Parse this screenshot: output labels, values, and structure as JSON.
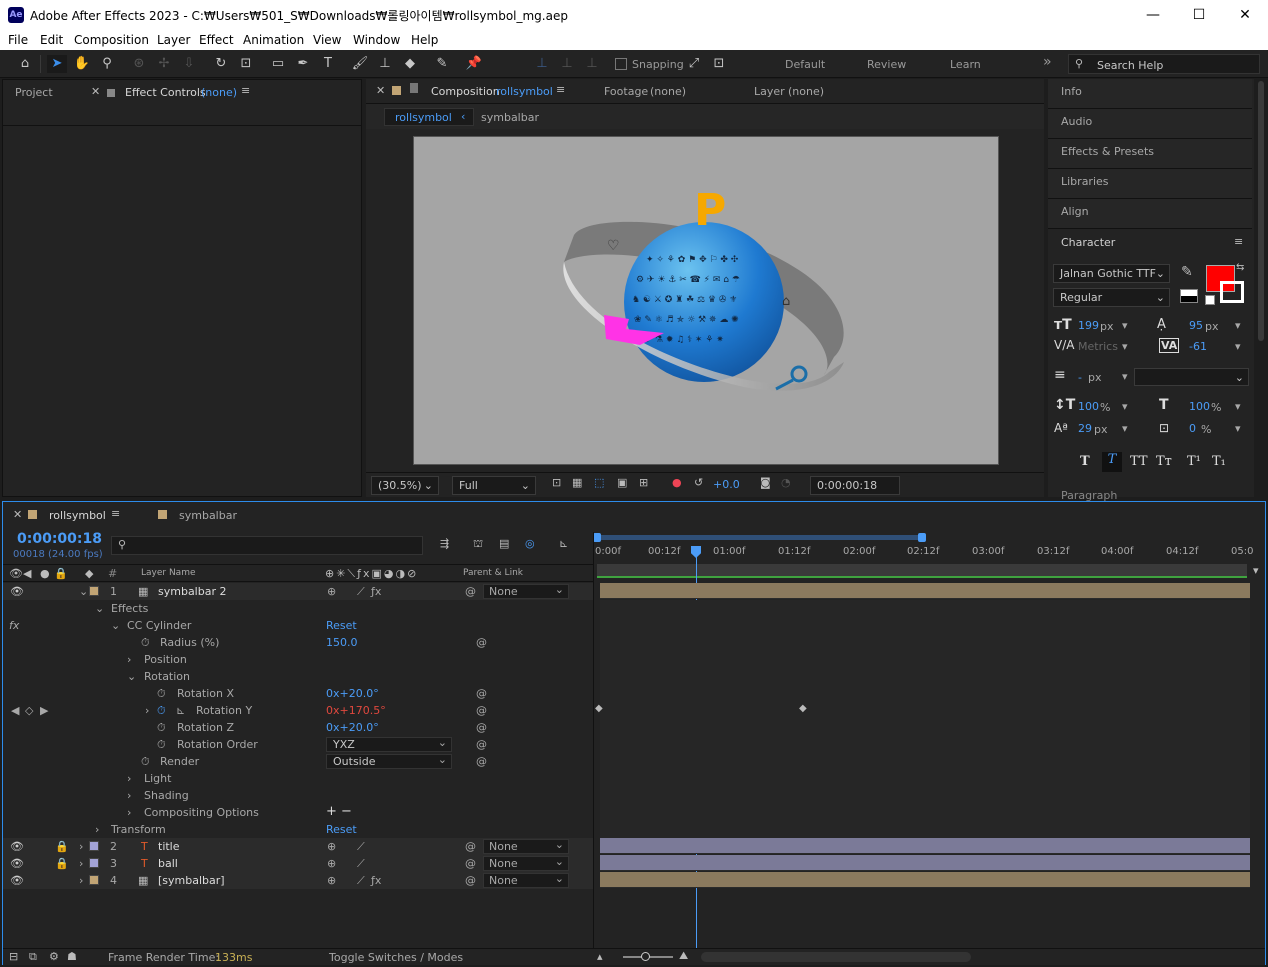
{
  "window": {
    "app_icon": "Ae",
    "title": "Adobe After Effects 2023 - C:₩Users₩501_S₩Downloads₩롤링아이템₩rollsymbol_mg.aep",
    "minimize": "—",
    "maximize": "☐",
    "close": "✕"
  },
  "menu": [
    "File",
    "Edit",
    "Composition",
    "Layer",
    "Effect",
    "Animation",
    "View",
    "Window",
    "Help"
  ],
  "toolbar": {
    "snapping_label": "Snapping",
    "workspaces": [
      "Default",
      "Review",
      "Learn"
    ],
    "more": "»",
    "search_placeholder": "Search Help"
  },
  "left_panel": {
    "tab_project": "Project",
    "tab_effect_controls": "Effect Controls",
    "effect_controls_target": "(none)"
  },
  "comp_panel": {
    "tab_composition": "Composition",
    "comp_name": "rollsymbol",
    "tab_footage": "Footage",
    "footage_target": "(none)",
    "tab_layer": "Layer",
    "layer_target": "(none)",
    "breadcrumbs": [
      "rollsymbol",
      "symbalbar"
    ],
    "footer": {
      "zoom": "(30.5%)",
      "resolution": "Full",
      "exposure": "+0.0",
      "timecode": "0:00:00:18"
    }
  },
  "right_panel": {
    "items": [
      "Info",
      "Audio",
      "Effects & Presets",
      "Libraries",
      "Align"
    ],
    "character": {
      "title": "Character",
      "font": "Jalnan Gothic TTF",
      "style": "Regular",
      "font_size": "199",
      "font_size_unit": "px",
      "leading": "95",
      "leading_unit": "px",
      "kerning": "Metrics",
      "tracking": "-61",
      "stroke_width": "-",
      "stroke_unit": "px",
      "vscale": "100",
      "vscale_unit": "%",
      "hscale": "100",
      "hscale_unit": "%",
      "baseline": "29",
      "baseline_unit": "px",
      "tsume": "0",
      "tsume_unit": "%",
      "fill_color": "#ff0000",
      "style_buttons": [
        "T",
        "T",
        "TT",
        "Tт",
        "T¹",
        "T₁"
      ]
    },
    "paragraph_title": "Paragraph"
  },
  "timeline": {
    "tabs": [
      "rollsymbol",
      "symbalbar"
    ],
    "timecode": "0:00:00:18",
    "frame_info": "00018 (24.00 fps)",
    "col_layer_name": "Layer Name",
    "col_parent": "Parent & Link",
    "ruler": [
      "0:00f",
      "00:12f",
      "01:00f",
      "01:12f",
      "02:00f",
      "02:12f",
      "03:00f",
      "03:12f",
      "04:00f",
      "04:12f",
      "05:0"
    ],
    "layers": [
      {
        "num": "1",
        "name": "symbalbar 2",
        "parent": "None",
        "color": "#c2a575",
        "icon": "precomp-icon"
      },
      {
        "num": "2",
        "name": "title",
        "parent": "None",
        "color": "#a3a3d6",
        "icon": "text-layer-icon"
      },
      {
        "num": "3",
        "name": "ball",
        "parent": "None",
        "color": "#a3a3d6",
        "icon": "text-layer-icon"
      },
      {
        "num": "4",
        "name": "[symbalbar]",
        "parent": "None",
        "color": "#c2a575",
        "icon": "precomp-icon"
      }
    ],
    "props": {
      "effects": "Effects",
      "cc_cylinder": "CC Cylinder",
      "reset": "Reset",
      "radius": "Radius (%)",
      "radius_val": "150.0",
      "position": "Position",
      "rotation": "Rotation",
      "rot_x": "Rotation X",
      "rot_x_val": "0x+20.0°",
      "rot_y": "Rotation Y",
      "rot_y_val": "0x+170.5°",
      "rot_z": "Rotation Z",
      "rot_z_val": "0x+20.0°",
      "rot_order": "Rotation Order",
      "rot_order_val": "YXZ",
      "render": "Render",
      "render_val": "Outside",
      "light": "Light",
      "shading": "Shading",
      "compositing": "Compositing Options",
      "transform": "Transform",
      "plus_minus": "+ −"
    },
    "footer": {
      "render_time_label": "Frame Render Time:",
      "render_time": "133ms",
      "toggle": "Toggle Switches / Modes"
    }
  },
  "viewer_text": {
    "logo": "P"
  }
}
